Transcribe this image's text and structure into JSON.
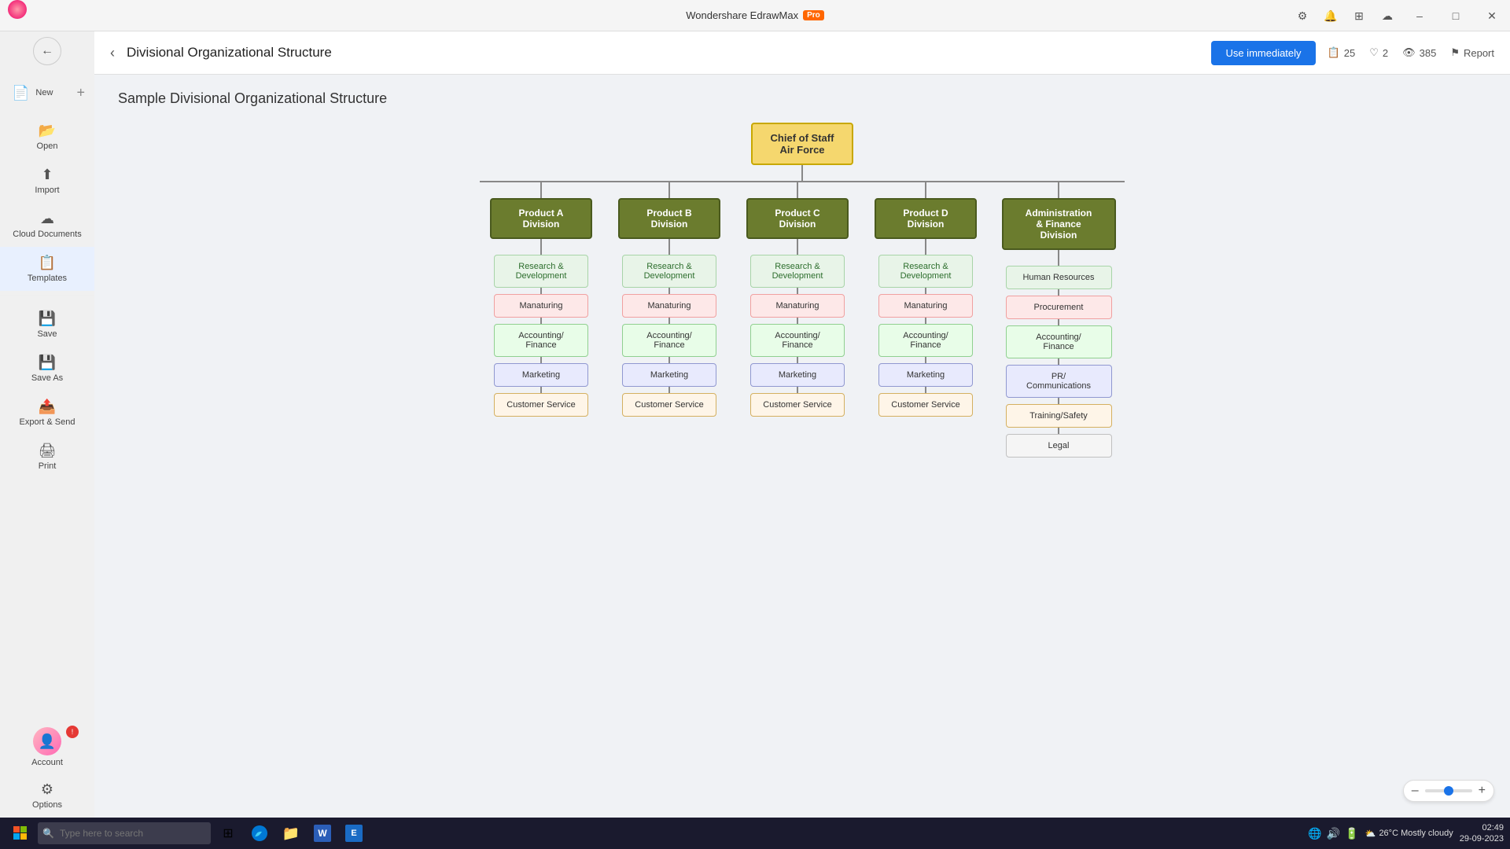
{
  "app": {
    "title": "Wondershare EdrawMax",
    "pro_badge": "Pro",
    "minimize": "–",
    "maximize": "□",
    "close": "✕"
  },
  "page": {
    "title": "Divisional Organizational Structure",
    "use_btn": "Use immediately",
    "stats": {
      "copies": "25",
      "likes": "2",
      "views": "385",
      "report": "Report"
    }
  },
  "sidebar": {
    "back": "←",
    "items": [
      {
        "id": "new",
        "label": "New",
        "icon": "+"
      },
      {
        "id": "open",
        "label": "Open",
        "icon": "📂"
      },
      {
        "id": "import",
        "label": "Import",
        "icon": "⬆"
      },
      {
        "id": "cloud",
        "label": "Cloud Documents",
        "icon": "☁"
      },
      {
        "id": "templates",
        "label": "Templates",
        "icon": "📋"
      },
      {
        "id": "save",
        "label": "Save",
        "icon": "💾"
      },
      {
        "id": "saveas",
        "label": "Save As",
        "icon": "💾"
      },
      {
        "id": "export",
        "label": "Export & Send",
        "icon": "📤"
      },
      {
        "id": "print",
        "label": "Print",
        "icon": "🖨"
      }
    ],
    "bottom": [
      {
        "id": "account",
        "label": "Account",
        "icon": "👤"
      },
      {
        "id": "options",
        "label": "Options",
        "icon": "⚙"
      }
    ]
  },
  "diagram": {
    "title": "Sample Divisional Organizational Structure",
    "chief": {
      "line1": "Chief of Staff",
      "line2": "Air Force"
    },
    "divisions": [
      {
        "id": "prod_a",
        "label": "Product A\nDivision"
      },
      {
        "id": "prod_b",
        "label": "Product B\nDivision"
      },
      {
        "id": "prod_c",
        "label": "Product C\nDivision"
      },
      {
        "id": "prod_d",
        "label": "Product D\nDivision"
      },
      {
        "id": "admin",
        "label": "Administration\n& Finance\nDivision"
      }
    ],
    "sub_items": {
      "product_cols": [
        [
          "Research &\nDevelopment",
          "Manaturing",
          "Accounting/\nFinance",
          "Marketing",
          "Customer Service"
        ],
        [
          "Research &\nDevelopment",
          "Manaturing",
          "Accounting/\nFinance",
          "Marketing",
          "Customer Service"
        ],
        [
          "Research &\nDevelopment",
          "Manaturing",
          "Accounting/\nFinance",
          "Marketing",
          "Customer Service"
        ],
        [
          "Research &\nDevelopment",
          "Manaturing",
          "Accounting/\nFinance",
          "Marketing",
          "Customer Service"
        ]
      ],
      "admin_col": [
        "Human Resources",
        "Procurement",
        "Accounting/\nFinance",
        "PR/\nCommunications",
        "Training/Safety",
        "Legal"
      ]
    }
  },
  "zoom": {
    "level": "100%",
    "minus": "–",
    "plus": "+"
  },
  "taskbar": {
    "search_placeholder": "Type here to search",
    "weather": "26°C  Mostly cloudy",
    "time": "02:49",
    "date": "29-09-2023"
  }
}
